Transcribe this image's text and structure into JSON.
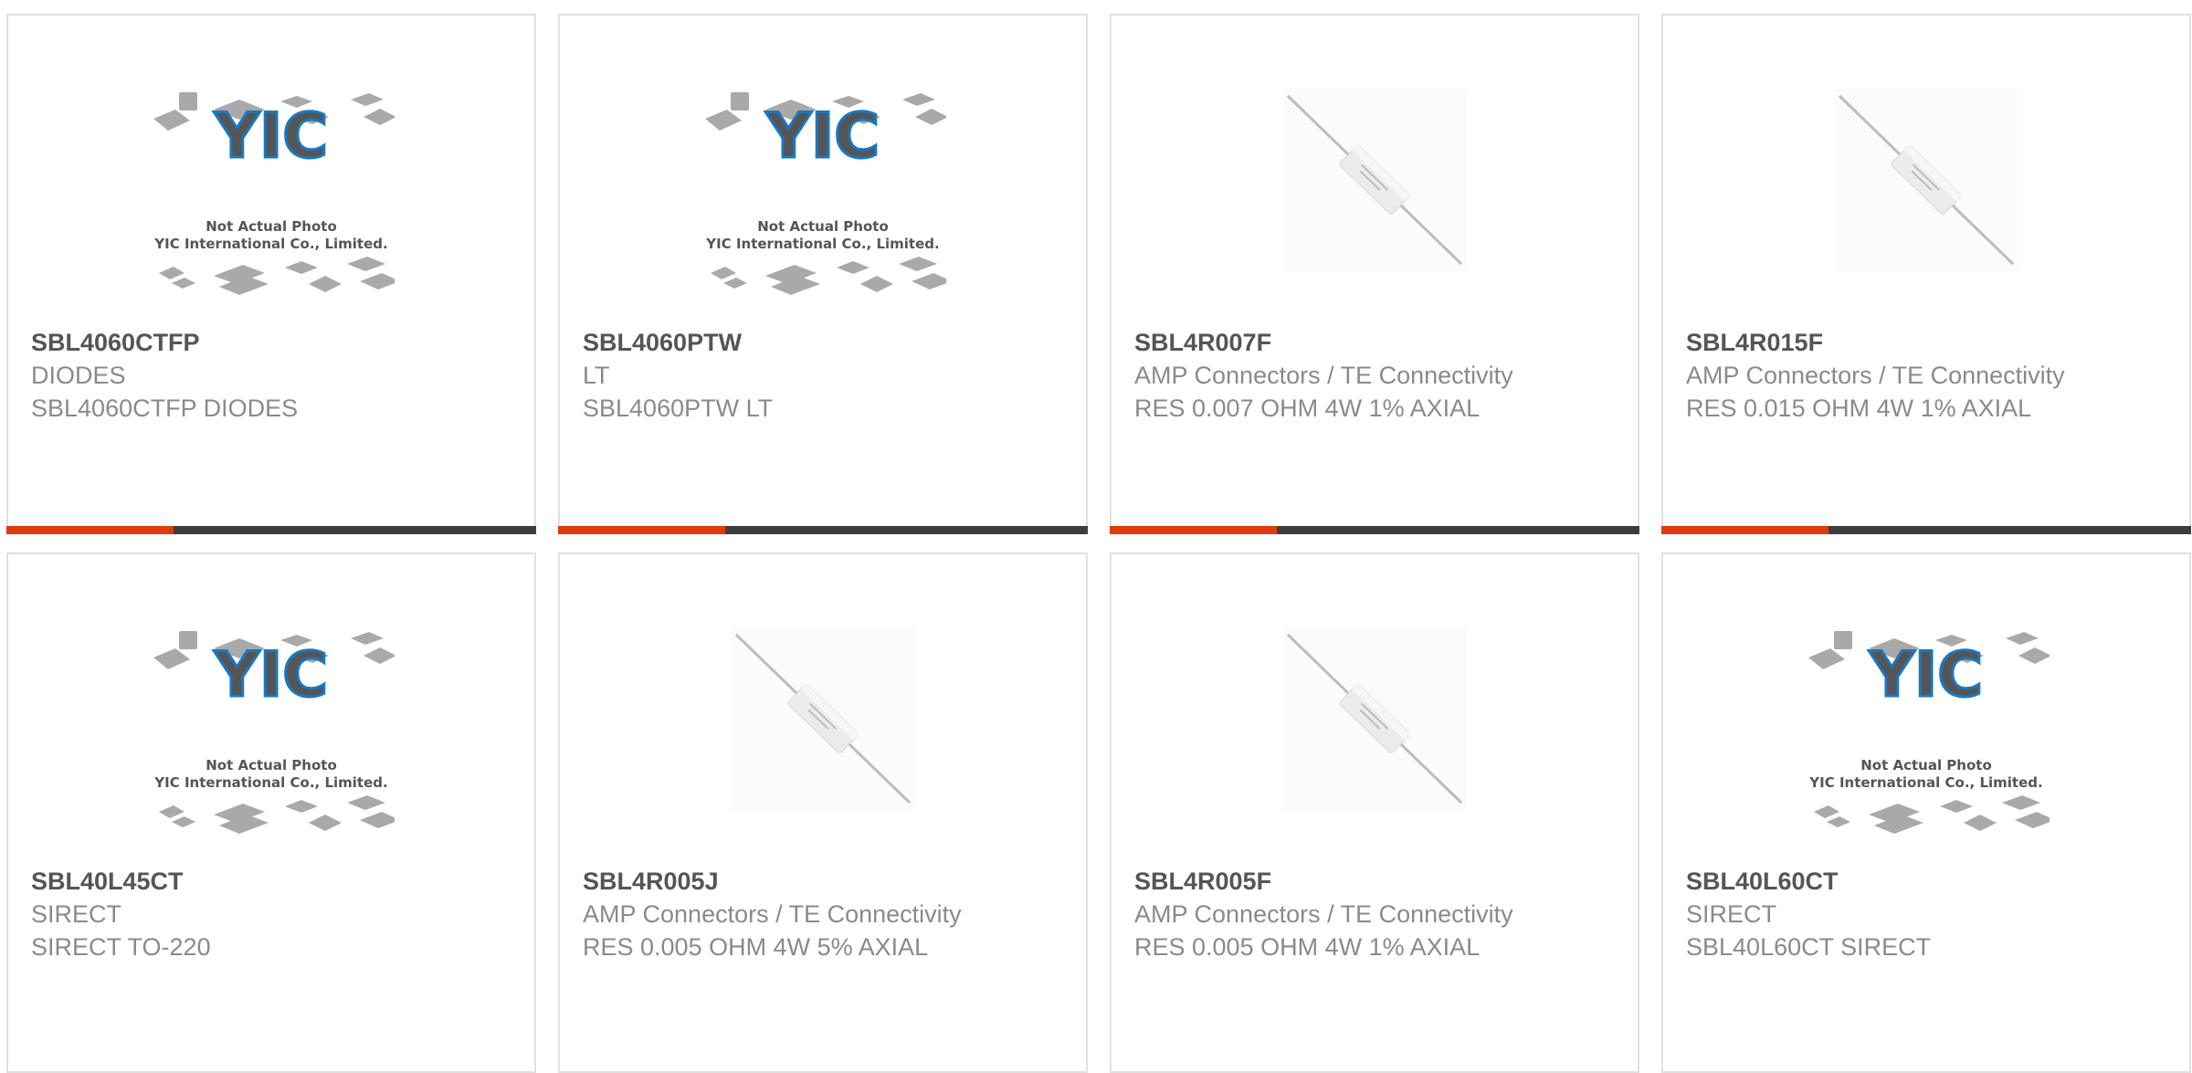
{
  "products": [
    {
      "part_number": "SBL4060CTFP",
      "manufacturer": "DIODES",
      "description": "SBL4060CTFP DIODES",
      "image": "placeholder-logo",
      "has_bar": true
    },
    {
      "part_number": "SBL4060PTW",
      "manufacturer": "LT",
      "description": "SBL4060PTW LT",
      "image": "placeholder-logo",
      "has_bar": true
    },
    {
      "part_number": "SBL4R007F",
      "manufacturer": "AMP Connectors / TE Connectivity",
      "description": "RES 0.007 OHM 4W 1% AXIAL",
      "image": "axial-resistor",
      "has_bar": true
    },
    {
      "part_number": "SBL4R015F",
      "manufacturer": "AMP Connectors / TE Connectivity",
      "description": "RES 0.015 OHM 4W 1% AXIAL",
      "image": "axial-resistor",
      "has_bar": true
    },
    {
      "part_number": "SBL40L45CT",
      "manufacturer": "SIRECT",
      "description": "SIRECT TO-220",
      "image": "placeholder-logo",
      "has_bar": false
    },
    {
      "part_number": "SBL4R005J",
      "manufacturer": "AMP Connectors / TE Connectivity",
      "description": "RES 0.005 OHM 4W 5% AXIAL",
      "image": "axial-resistor",
      "has_bar": false
    },
    {
      "part_number": "SBL4R005F",
      "manufacturer": "AMP Connectors / TE Connectivity",
      "description": "RES 0.005 OHM 4W 1% AXIAL",
      "image": "axial-resistor",
      "has_bar": false
    },
    {
      "part_number": "SBL40L60CT",
      "manufacturer": "SIRECT",
      "description": "SBL40L60CT SIRECT",
      "image": "placeholder-logo",
      "has_bar": false
    }
  ],
  "placeholder": {
    "logo_text": "YIC",
    "caption_line1": "Not Actual Photo",
    "caption_line2": "YIC International Co., Limited."
  },
  "colors": {
    "accent": "#e03a0c",
    "bar": "#3d3d3d",
    "logo_blue": "#1a78c2",
    "card_border": "#e1e1e1"
  }
}
